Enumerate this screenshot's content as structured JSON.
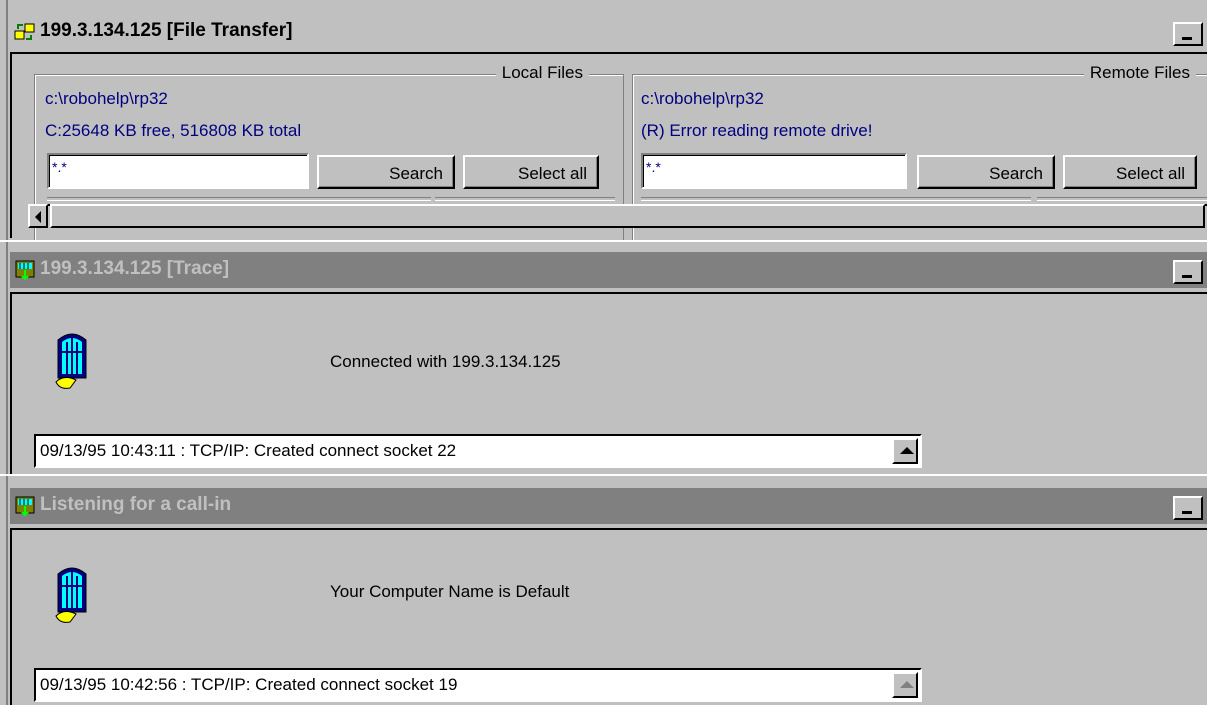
{
  "file_transfer": {
    "title": "199.3.134.125 [File Transfer]",
    "local": {
      "legend": "Local Files",
      "path": "c:\\robohelp\\rp32",
      "drive_info": "C:25648 KB free, 516808 KB total",
      "filter": "*.*",
      "search_label": "Search",
      "search_accel": "h",
      "select_all_label": "Select all",
      "select_all_accel": "a"
    },
    "remote": {
      "legend": "Remote Files",
      "path": "c:\\robohelp\\rp32",
      "drive_info": "(R) Error reading remote drive!",
      "filter": "*.*",
      "search_label": "Search",
      "search_accel": "c",
      "select_all_label": "Select all",
      "select_all_accel": "l"
    }
  },
  "trace": {
    "title": "199.3.134.125 [Trace]",
    "status": "Connected with 199.3.134.125",
    "log": "09/13/95 10:43:11 : TCP/IP: Created connect socket 22"
  },
  "listen": {
    "title": "Listening for a call-in",
    "status": "Your Computer Name is Default",
    "log": "09/13/95 10:42:56 : TCP/IP: Created connect socket 19"
  },
  "icons": {
    "title_transfer": "file-transfer-icon",
    "title_trace": "network-plug-icon",
    "status": "phone-booth-icon"
  },
  "colors": {
    "face": "#c0c0c0",
    "inactive_title": "#808080",
    "link_blue": "#000080"
  }
}
